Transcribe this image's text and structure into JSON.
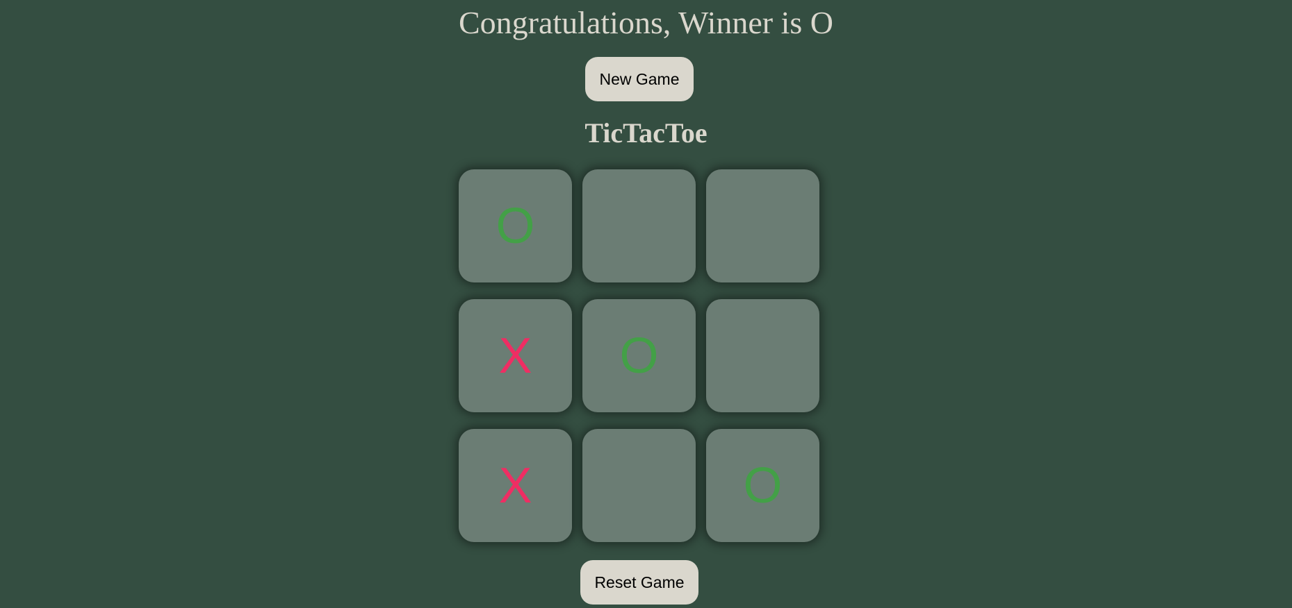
{
  "status": {
    "message": "Congratulations, Winner is O"
  },
  "buttons": {
    "new_game": "New Game",
    "reset_game": "Reset Game"
  },
  "game": {
    "title": "TicTacToe",
    "board": [
      "O",
      "",
      "",
      "X",
      "O",
      "",
      "X",
      "",
      "O"
    ]
  },
  "colors": {
    "background": "#344e41",
    "text": "#dad7cd",
    "button": "#dad7cd",
    "cell": "#6b7d74",
    "o_mark": "#43a047",
    "x_mark": "#ef2d63"
  }
}
